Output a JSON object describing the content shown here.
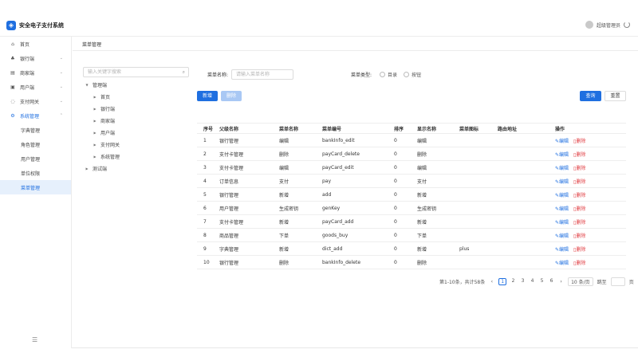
{
  "header": {
    "title": "安全电子支付系统",
    "user_name": "超级管理员"
  },
  "sidebar": {
    "items": [
      {
        "icon": "home-icon",
        "glyph": "⌂",
        "label": "首页",
        "chevron": ""
      },
      {
        "icon": "merchant-icon",
        "glyph": "♣",
        "label": "银行端",
        "chevron": "⌄"
      },
      {
        "icon": "merchant-list-icon",
        "glyph": "▤",
        "label": "商家端",
        "chevron": "⌄"
      },
      {
        "icon": "user-icon",
        "glyph": "▣",
        "label": "用户端",
        "chevron": "⌄"
      },
      {
        "icon": "gateway-icon",
        "glyph": "◌",
        "label": "支付网关",
        "chevron": "⌄"
      },
      {
        "icon": "settings-icon",
        "glyph": "⚙",
        "label": "系统管理",
        "chevron": "⌃"
      }
    ],
    "sub_items": [
      "字典管理",
      "角色管理",
      "用户管理",
      "单位权限",
      "菜单管理"
    ],
    "collapse_glyph": "☰"
  },
  "tabs": {
    "current": "菜单管理"
  },
  "tree": {
    "search_placeholder": "输入关键字搜索",
    "nodes": [
      {
        "label": "管理端",
        "level": 0,
        "arrow": "▼"
      },
      {
        "label": "首页",
        "level": 1,
        "arrow": "▶"
      },
      {
        "label": "银行端",
        "level": 1,
        "arrow": "▶"
      },
      {
        "label": "商家端",
        "level": 1,
        "arrow": "▶"
      },
      {
        "label": "用户端",
        "level": 1,
        "arrow": "▶"
      },
      {
        "label": "支付网关",
        "level": 1,
        "arrow": "▶"
      },
      {
        "label": "系统管理",
        "level": 1,
        "arrow": "▶"
      },
      {
        "label": "测试端",
        "level": 0,
        "arrow": "▶"
      }
    ]
  },
  "filter": {
    "name_label": "菜单名称:",
    "name_placeholder": "请输入菜单名称",
    "type_label": "菜单类型:",
    "type_options": [
      "目录",
      "按钮"
    ]
  },
  "buttons": {
    "add": "新增",
    "delete": "删除",
    "search": "查询",
    "reset": "重置"
  },
  "table": {
    "columns": [
      "序号",
      "父级名称",
      "菜单名称",
      "菜单编号",
      "排序",
      "显示名称",
      "菜单图标",
      "路由地址",
      "操作"
    ],
    "rows": [
      [
        "1",
        "银行管理",
        "编辑",
        "bankInfo_edit",
        "0",
        "编辑",
        "",
        ""
      ],
      [
        "2",
        "支付卡管理",
        "删除",
        "payCard_delete",
        "0",
        "删除",
        "",
        ""
      ],
      [
        "3",
        "支付卡管理",
        "编辑",
        "payCard_edit",
        "0",
        "编辑",
        "",
        ""
      ],
      [
        "4",
        "订单信息",
        "支付",
        "pay",
        "0",
        "支付",
        "",
        ""
      ],
      [
        "5",
        "银行管理",
        "新增",
        "add",
        "0",
        "新增",
        "",
        ""
      ],
      [
        "6",
        "用户管理",
        "生成密钥",
        "genKey",
        "0",
        "生成密钥",
        "",
        ""
      ],
      [
        "7",
        "支付卡管理",
        "新增",
        "payCard_add",
        "0",
        "新增",
        "",
        ""
      ],
      [
        "8",
        "商品管理",
        "下单",
        "goods_buy",
        "0",
        "下单",
        "",
        ""
      ],
      [
        "9",
        "字典管理",
        "新增",
        "dict_add",
        "0",
        "新增",
        "plus",
        ""
      ],
      [
        "10",
        "银行管理",
        "删除",
        "bankInfo_delete",
        "0",
        "删除",
        "",
        ""
      ]
    ],
    "edit_label": "编辑",
    "delete_label": "删除"
  },
  "pagination": {
    "summary": "第1-10条，共计58条",
    "pages": [
      "1",
      "2",
      "3",
      "4",
      "5",
      "6"
    ],
    "current": "1",
    "page_size": "10 条/页",
    "jump_label": "跳至",
    "page_unit": "页"
  }
}
